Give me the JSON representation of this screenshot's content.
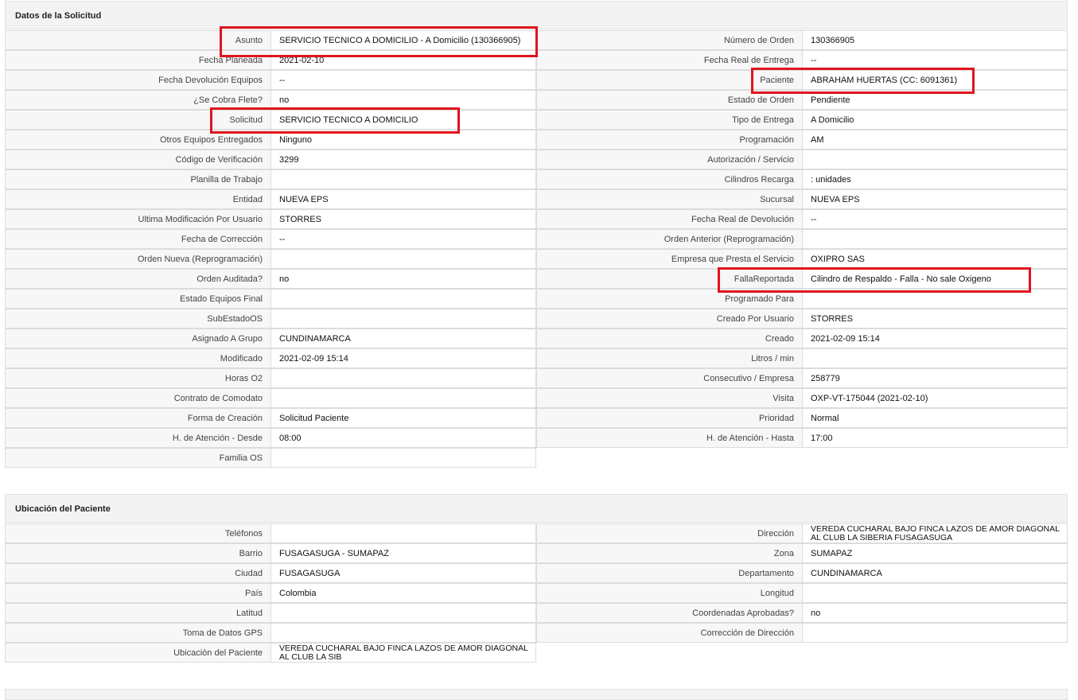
{
  "sections": {
    "solicitud": {
      "title": "Datos de la Solicitud",
      "rows": [
        {
          "l1": "Asunto",
          "v1": "SERVICIO TECNICO A DOMICILIO - A Domicilio (130366905)",
          "l2": "Número de Orden",
          "v2": "130366905"
        },
        {
          "l1": "Fecha Planeada",
          "v1": "2021-02-10",
          "l2": "Fecha Real de Entrega",
          "v2": "--"
        },
        {
          "l1": "Fecha Devolución Equipos",
          "v1": "--",
          "l2": "Paciente",
          "v2": "ABRAHAM HUERTAS (CC: 6091361)"
        },
        {
          "l1": "¿Se Cobra Flete?",
          "v1": "no",
          "l2": "Estado de Orden",
          "v2": "Pendiente"
        },
        {
          "l1": "Solicitud",
          "v1": "SERVICIO TECNICO A DOMICILIO",
          "l2": "Tipo de Entrega",
          "v2": "A Domicilio"
        },
        {
          "l1": "Otros Equipos Entregados",
          "v1": "Ninguno",
          "l2": "Programación",
          "v2": "AM"
        },
        {
          "l1": "Código de Verificación",
          "v1": "3299",
          "l2": "Autorización / Servicio",
          "v2": ""
        },
        {
          "l1": "Planilla de Trabajo",
          "v1": "",
          "l2": "Cilindros Recarga",
          "v2": ": unidades"
        },
        {
          "l1": "Entidad",
          "v1": "NUEVA EPS",
          "l2": "Sucursal",
          "v2": "NUEVA EPS"
        },
        {
          "l1": "Ultima Modificación Por Usuario",
          "v1": "STORRES",
          "l2": "Fecha Real de Devolución",
          "v2": "--"
        },
        {
          "l1": "Fecha de Corrección",
          "v1": "--",
          "l2": "Orden Anterior (Reprogramación)",
          "v2": ""
        },
        {
          "l1": "Orden Nueva (Reprogramación)",
          "v1": "",
          "l2": "Empresa que Presta el Servicio",
          "v2": "OXIPRO SAS"
        },
        {
          "l1": "Orden Auditada?",
          "v1": "no",
          "l2": "FallaReportada",
          "v2": "Cilindro de Respaldo - Falla - No sale Oxigeno"
        },
        {
          "l1": "Estado Equipos Final",
          "v1": "",
          "l2": "Programado Para",
          "v2": ""
        },
        {
          "l1": "SubEstadoOS",
          "v1": "",
          "l2": "Creado Por Usuario",
          "v2": "STORRES"
        },
        {
          "l1": "Asignado A Grupo",
          "v1": "CUNDINAMARCA",
          "l2": "Creado",
          "v2": "2021-02-09 15:14"
        },
        {
          "l1": "Modificado",
          "v1": "2021-02-09 15:14",
          "l2": "Litros / min",
          "v2": ""
        },
        {
          "l1": "Horas O2",
          "v1": "",
          "l2": "Consecutivo / Empresa",
          "v2": "258779"
        },
        {
          "l1": "Contrato de Comodato",
          "v1": "",
          "l2": "Visita",
          "v2": "OXP-VT-175044 (2021-02-10)"
        },
        {
          "l1": "Forma de Creación",
          "v1": "Solicitud Paciente",
          "l2": "Prioridad",
          "v2": "Normal"
        },
        {
          "l1": "H. de Atención - Desde",
          "v1": "08:00",
          "l2": "H. de Atención - Hasta",
          "v2": "17:00"
        },
        {
          "l1": "Familia OS",
          "v1": ""
        }
      ]
    },
    "ubicacion": {
      "title": "Ubicación del Paciente",
      "rows": [
        {
          "l1": "Teléfonos",
          "v1": "",
          "l2": "Dirección",
          "v2": "VEREDA CUCHARAL BAJO FINCA LAZOS DE AMOR DIAGONAL AL CLUB LA SIBERIA FUSAGASUGA"
        },
        {
          "l1": "Barrio",
          "v1": "FUSAGASUGA - SUMAPAZ",
          "l2": "Zona",
          "v2": "SUMAPAZ"
        },
        {
          "l1": "Ciudad",
          "v1": "FUSAGASUGA",
          "l2": "Departamento",
          "v2": "CUNDINAMARCA"
        },
        {
          "l1": "País",
          "v1": "Colombia",
          "l2": "Longitud",
          "v2": ""
        },
        {
          "l1": "Latitud",
          "v1": "",
          "l2": "Coordenadas Aprobadas?",
          "v2": "no"
        },
        {
          "l1": "Toma de Datos GPS",
          "v1": "",
          "l2": "Corrección de Dirección",
          "v2": ""
        },
        {
          "l1": "Ubicación del Paciente",
          "v1": "VEREDA CUCHARAL BAJO FINCA LAZOS DE AMOR DIAGONAL AL CLUB LA SIB"
        }
      ]
    }
  },
  "colors": {
    "highlight": "#e0141e",
    "header_bg": "#f3f3f3",
    "label_bg": "#f7f7f7",
    "border": "#dcdcdc"
  }
}
